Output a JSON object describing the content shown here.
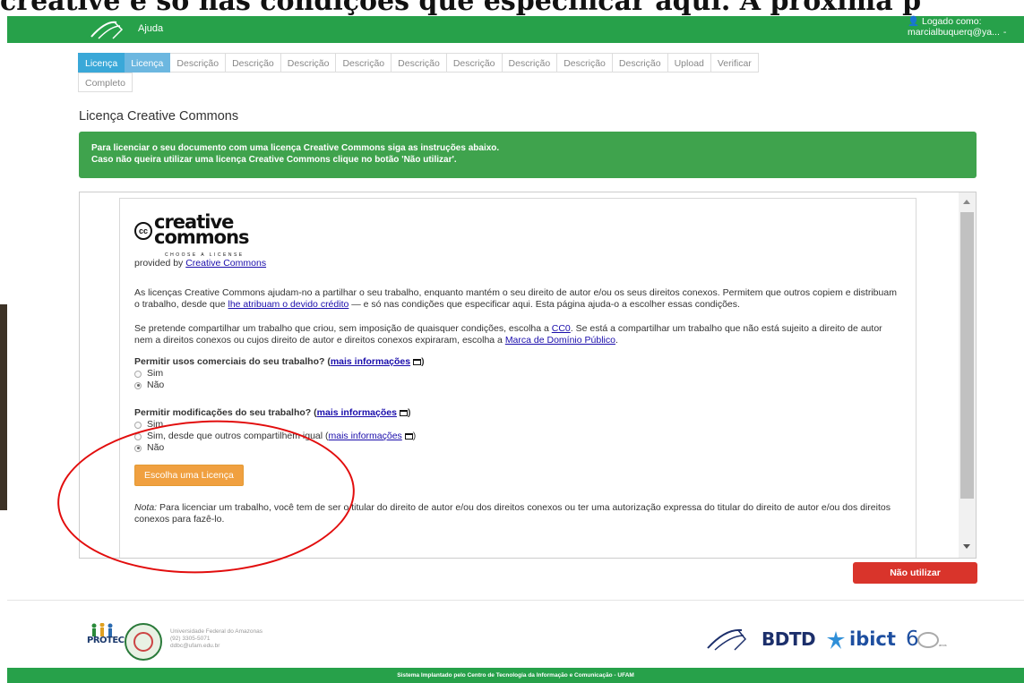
{
  "background_text": "creative e só nas condições que especificar aqui. A próxima p",
  "nav": {
    "help": "Ajuda",
    "user_label": "Logado como:",
    "user_email": "marcialbuquerq@ya...",
    "caret": "-"
  },
  "tabs": [
    {
      "label": "Licença"
    },
    {
      "label": "Licença"
    },
    {
      "label": "Descrição"
    },
    {
      "label": "Descrição"
    },
    {
      "label": "Descrição"
    },
    {
      "label": "Descrição"
    },
    {
      "label": "Descrição"
    },
    {
      "label": "Descrição"
    },
    {
      "label": "Descrição"
    },
    {
      "label": "Descrição"
    },
    {
      "label": "Descrição"
    },
    {
      "label": "Upload"
    },
    {
      "label": "Verificar"
    },
    {
      "label": "Completo"
    }
  ],
  "page_title": "Licença Creative Commons",
  "alert": {
    "line1": "Para licenciar o seu documento com uma licença Creative Commons siga as instruções abaixo.",
    "line2": "Caso não queira utilizar uma licença Creative Commons clique no botão 'Não utilizar'."
  },
  "cc": {
    "logo_cc": "cc",
    "logo_word1": "creative",
    "logo_word2": "commons",
    "logo_sub": "CHOOSE A LICENSE",
    "provided_by": "provided by ",
    "provided_link": "Creative Commons",
    "para1_a": "As licenças Creative Commons ajudam-no a partilhar o seu trabalho, enquanto mantém o seu direito de autor e/ou os seus direitos conexos. Permitem que outros copiem e distribuam o trabalho, desde que ",
    "para1_link": "lhe atribuam o devido crédito",
    "para1_b": " — e só nas condições que especificar aqui. Esta página ajuda-o a escolher essas condições.",
    "para2_a": "Se pretende compartilhar um trabalho que criou, sem imposição de quaisquer condições, escolha a ",
    "para2_link1": "CC0",
    "para2_b": ". Se está a compartilhar um trabalho que não está sujeito a direito de autor nem a direitos conexos ou cujos direito de autor e direitos conexos expiraram, escolha a ",
    "para2_link2": "Marca de Domínio Público",
    "para2_c": ".",
    "q1": "Permitir usos comerciais do seu trabalho? (",
    "q_more": "mais informações",
    "q_close": ")",
    "q1_options": [
      "Sim",
      "Não"
    ],
    "q1_selected": "Não",
    "q2": "Permitir modificações do seu trabalho? (",
    "q2_opt1": "Sim",
    "q2_opt2": "Sim, desde que outros compartilhem igual (",
    "q2_opt3": "Não",
    "q2_selected": "Não",
    "choose_button": "Escolha uma Licença",
    "note_label": "Nota:",
    "note_text": " Para licenciar um trabalho, você tem de ser o titular do direito de autor e/ou dos direitos conexos ou ter uma autorização expressa do titular do direito de autor e/ou dos direitos conexos para fazê-lo."
  },
  "nao_utilizar": "Não utilizar",
  "footer": {
    "protec": "PROTEC",
    "ufam_name": "Universidade Federal do Amazonas",
    "ufam_phone": "(92) 3305-5071",
    "ufam_email": "ddbc@ufam.edu.br",
    "bdtd": "BDTD",
    "ibict": "ibict",
    "ibict_60": "6",
    "ibict_anos": "anos",
    "bottom": "Sistema Implantado pelo Centro de Tecnologia da Informação e Comunicação - UFAM"
  },
  "colors": {
    "nav_green": "#27a14a",
    "alert_green": "#3fa34d",
    "tab_active": "#3aa8d8",
    "choose_orange": "#f0a040",
    "nao_red": "#d9342b",
    "annotation_red": "#e20d0d"
  }
}
